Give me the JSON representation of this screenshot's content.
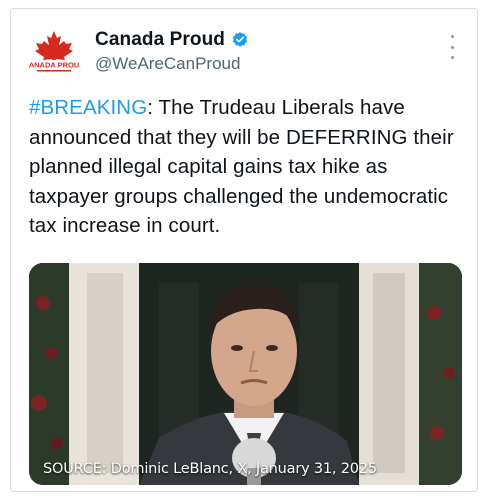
{
  "tweet": {
    "author": {
      "display_name": "Canada Proud",
      "handle": "@WeAreCanProud",
      "avatar_text": "CANADA PROUD",
      "verified_icon": "verified-badge-icon"
    },
    "more_icon": "more-options-icon",
    "text": {
      "hashtag": "#BREAKING",
      "body": ": The Trudeau Liberals have announced that they will be DEFERRING their planned illegal capital gains tax hike as taxpayer groups challenged the undemocratic tax increase in court."
    },
    "media": {
      "caption": "SOURCE: Dominic LeBlanc, X, January 31, 2025"
    },
    "colors": {
      "hashtag": "#1d9bf0",
      "verified": "#1d9bf0",
      "brand_red": "#d52b1e"
    }
  }
}
